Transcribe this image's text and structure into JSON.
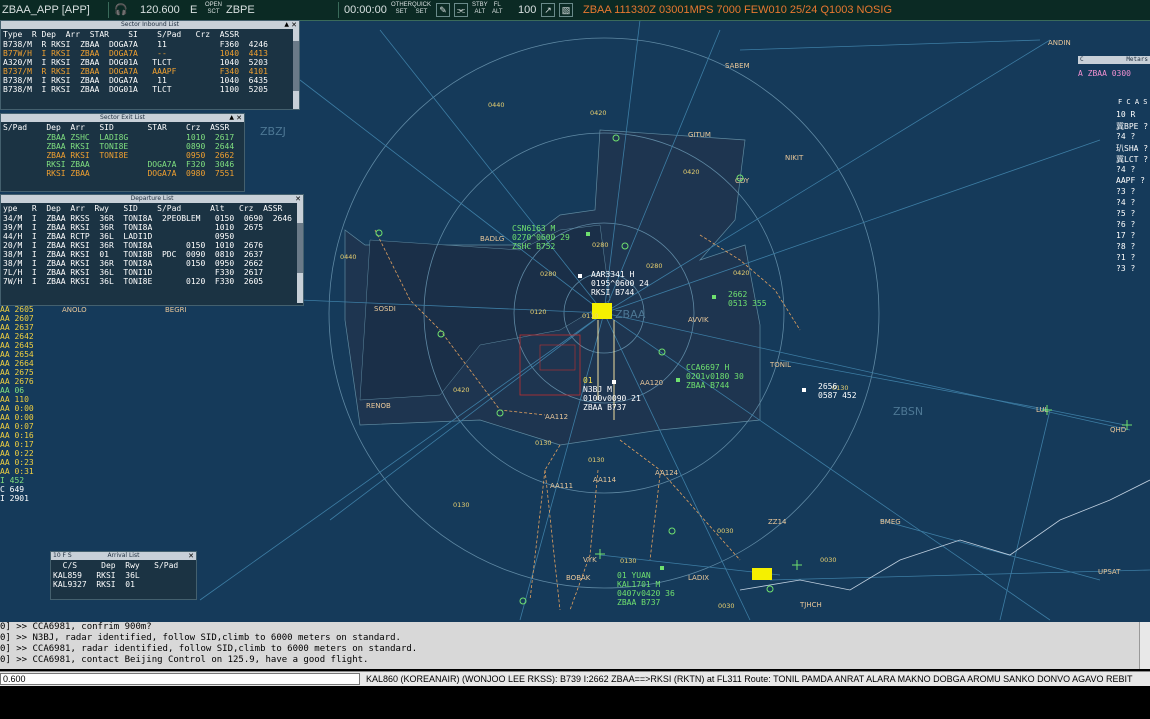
{
  "topbar": {
    "position": "ZBAA_APP [APP]",
    "frequency": "120.600",
    "direction": "E",
    "open_sct_top": "OPEN",
    "open_sct_bottom": "SCT",
    "sector": "ZBPE",
    "clock": "00:00:00",
    "other_set_top": "OTHER",
    "other_set_bottom": "SET",
    "quick_set_top": "QUICK",
    "quick_set_bottom": "SET",
    "stby_alt_top": "STBY",
    "stby_alt_bottom": "ALT",
    "fl_alt_top": "FL",
    "fl_alt_bottom": "ALT",
    "range": "100",
    "metar": "ZBAA 111330Z 03001MPS 7000 FEW010 25/24 Q1003 NOSIG",
    "icons": [
      "headset-icon",
      "tool-a-icon",
      "tool-b-icon",
      "tool-c-icon",
      "tool-d-icon",
      "tool-e-icon",
      "tool-f-icon"
    ]
  },
  "inbound": {
    "title": "Sector Inbound List",
    "headers": "Type  R Dep  Arr  STAR    SI    S/Pad   Crz  ASSR",
    "rows": [
      {
        "text": "B738/M  R RKSI  ZBAA  DOGA7A    11           F360  4246",
        "color": "w"
      },
      {
        "text": "B77W/H  I RKSI  ZBAA  DOGA7A    --           1040  4413",
        "color": "o"
      },
      {
        "text": "A320/M  I RKSI  ZBAA  DOG01A   TLCT          1040  5203",
        "color": "w"
      },
      {
        "text": "B737/M  R RKSI  ZBAA  DOGA7A   AAAPF         F340  4101",
        "color": "o"
      },
      {
        "text": "B738/M  I RKSI  ZBAA  DOGA7A    11           1040  6435",
        "color": "w"
      },
      {
        "text": "B738/M  I RKSI  ZBAA  DOG01A   TLCT          1100  5205",
        "color": "w"
      }
    ]
  },
  "exit": {
    "title": "Sector Exit List",
    "headers": "S/Pad    Dep  Arr   SID       STAR    Crz  ASSR",
    "rows": [
      {
        "text": "         ZBAA ZSHC  LADI8G            1010  2617",
        "color": "g"
      },
      {
        "text": "         ZBAA RKSI  TONI8E            0890  2644",
        "color": "g"
      },
      {
        "text": "         ZBAA RKSI  TONI8E            0950  2662",
        "color": "o"
      },
      {
        "text": "         RKSI ZBAA            DOGA7A  F320  3046",
        "color": "g"
      },
      {
        "text": "         RKSI ZBAA            DOGA7A  0980  7551",
        "color": "o"
      }
    ]
  },
  "departure": {
    "title": "Departure List",
    "headers": "ype   R  Dep  Arr  Rwy   SID    S/Pad      Alt   Crz  ASSR",
    "rows": [
      {
        "text": "34/M  I  ZBAA RKSS  36R  TONI8A  2PEOBLEM   0150  0690  2646",
        "color": "w"
      },
      {
        "text": "39/M  I  ZBAA RKSI  36R  TONI8A             1010  2675",
        "color": "w"
      },
      {
        "text": "44/H  I  ZBAA RCTP  36L  LADI1D             0950",
        "color": "w"
      },
      {
        "text": "20/M  I  ZBAA RKSI  36R  TONI8A       0150  1010  2676",
        "color": "w"
      },
      {
        "text": "38/M  I  ZBAA RKSI  01   TONI8B  PDC  0090  0810  2637",
        "color": "w"
      },
      {
        "text": "38/M  I  ZBAA RKSI  36R  TONI8A       0150  0950  2662",
        "color": "w"
      },
      {
        "text": "7L/H  I  ZBAA RKSI  36L  TONI1D             F330  2617",
        "color": "w"
      },
      {
        "text": "7W/H  I  ZBAA RKSI  36L  TONI8E       0120  F330  2605",
        "color": "w"
      }
    ]
  },
  "arrival": {
    "title": "Arrival List",
    "tabs": "10  F  S",
    "headers": "  C/S     Dep  Rwy   S/Pad",
    "rows": [
      {
        "text": "KAL859   RKSI  36L",
        "color": "w"
      },
      {
        "text": "KAL9327  RKSI  01",
        "color": "w"
      }
    ]
  },
  "strip": [
    {
      "t": "AA 2605",
      "c": "y"
    },
    {
      "t": "AA 2607",
      "c": "y"
    },
    {
      "t": "AA 2637",
      "c": "y"
    },
    {
      "t": "AA 2642",
      "c": "y"
    },
    {
      "t": "AA 2645",
      "c": "y"
    },
    {
      "t": "AA 2654",
      "c": "y"
    },
    {
      "t": "AA 2664",
      "c": "y"
    },
    {
      "t": "AA 2675",
      "c": "y"
    },
    {
      "t": "AA 2676",
      "c": "y"
    },
    {
      "t": "AA 06",
      "c": "gn"
    },
    {
      "t": "AA 110",
      "c": "y"
    },
    {
      "t": "AA 0:00",
      "c": "y"
    },
    {
      "t": "AA 0:00",
      "c": "y"
    },
    {
      "t": "AA 0:07",
      "c": "y"
    },
    {
      "t": "AA 0:16",
      "c": "y"
    },
    {
      "t": "AA 0:17",
      "c": "y"
    },
    {
      "t": "AA 0:22",
      "c": "y"
    },
    {
      "t": "AA 0:23",
      "c": "y"
    },
    {
      "t": "AA 0:31",
      "c": "y"
    },
    {
      "t": "I 452",
      "c": "gn"
    },
    {
      "t": "C 649",
      "c": "wh"
    },
    {
      "t": "I 2901",
      "c": "wh"
    }
  ],
  "rpanel": {
    "metar_label": "Metars",
    "metar_line": "A ZBAA 0300",
    "cols": "F C A S",
    "lines": [
      "10 R",
      "冀BPE ?",
      "?4 ?",
      "玐SHA ?",
      "冀LCT ?",
      "?4 ?",
      "AAPF ?",
      "?3 ?",
      "?4 ?",
      "?5 ?",
      "?6 ?",
      "17 ?",
      "?8 ?",
      "?1 ?",
      "?3 ?"
    ]
  },
  "map": {
    "center_label": "ZBAA",
    "zbzj": "ZBZJ",
    "zbsn": "ZBSN",
    "fixes": [
      "ANDIN",
      "SABEM",
      "GITUM",
      "NIKIT",
      "CDY",
      "BADLG",
      "SOSDI",
      "ANOLO",
      "BEGRI",
      "RENOB",
      "TONIL",
      "AVVIK",
      "BOBAK",
      "VYK",
      "LADIX",
      "TJHCH",
      "UPSAT",
      "BMEG",
      "LUL",
      "QHD",
      "ZZ14",
      "AA111",
      "AA124",
      "AA114",
      "AA112",
      "AA120"
    ],
    "tracks": [
      {
        "id": "csn6163",
        "l1": "CSN6163 M",
        "l2": "0270^0600 29",
        "l3": "ZSHC B752",
        "color": "g"
      },
      {
        "id": "aar3341",
        "l1": "AAR3341 H",
        "l2": "0195^0600 24",
        "l3": "RKSI B744",
        "color": "w"
      },
      {
        "id": "t2662",
        "l1": "2662",
        "l2": "0513 355",
        "l3": "",
        "color": "g"
      },
      {
        "id": "cca6697",
        "l1": "CCA6697 H",
        "l2": "0201v0180 30",
        "l3": "ZBAA B744",
        "color": "g"
      },
      {
        "id": "n3bj",
        "l1": "01",
        "l2": "N3BJ M",
        "l3": "0100v0090 21",
        "l4": "ZBAA B737",
        "color": "w"
      },
      {
        "id": "t2656",
        "l1": "2656",
        "l2": "0587 452",
        "l3": "",
        "color": "w"
      },
      {
        "id": "kal1701",
        "l1": "01  YUAN",
        "l2": "KAL1701 M",
        "l3": "0407v0420 36",
        "l4": "ZBAA B737",
        "color": "g"
      }
    ],
    "alts": [
      "0440",
      "0420",
      "0420",
      "0420",
      "0440",
      "0280",
      "0280",
      "0280",
      "0120",
      "0110",
      "0130",
      "0130",
      "0130",
      "0030",
      "0030",
      "0030",
      "0130",
      "0130",
      "0420"
    ]
  },
  "console": {
    "lines": [
      "0] >> CCA6981, confrim 900m?",
      "0] >> N3BJ, radar identified, follow SID,climb to 6000 meters on standard.",
      "0] >> CCA6981, radar identified, follow SID,climb to 6000 meters on standard.",
      "0] >> CCA6981, contact Beijing Control on 125.9, have a good flight."
    ]
  },
  "cmdbar": {
    "input_value": "0.600",
    "flight_info": "KAL860 (KOREANAIR) (WONJOO LEE RKSS): B739 I:2662 ZBAA==>RKSI (RKTN) at FL311 Route: TONIL PAMDA ANRAT ALARA MAKNO DOBGA AROMU SANKO DONVO AGAVO REBIT"
  }
}
